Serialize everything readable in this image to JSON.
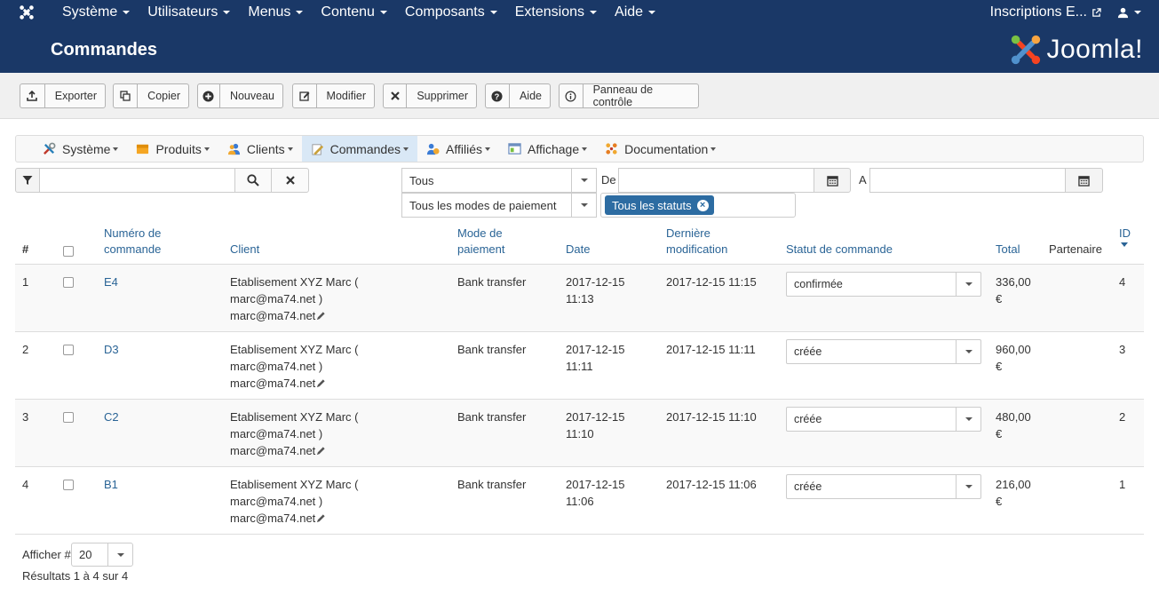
{
  "topbar": {
    "menu": [
      "Système",
      "Utilisateurs",
      "Menus",
      "Contenu",
      "Composants",
      "Extensions",
      "Aide"
    ],
    "site_label": "Inscriptions E...",
    "icons": {
      "logo": "joomla-icon",
      "external": "external-link-icon",
      "user": "user-icon"
    }
  },
  "header": {
    "title": "Commandes",
    "brand": "Joomla!"
  },
  "toolbar": {
    "buttons": [
      {
        "label": "Exporter",
        "icon": "upload-icon"
      },
      {
        "label": "Copier",
        "icon": "copy-icon"
      },
      {
        "label": "Nouveau",
        "icon": "plus-circle-icon"
      },
      {
        "label": "Modifier",
        "icon": "edit-icon"
      },
      {
        "label": "Supprimer",
        "icon": "x-icon"
      },
      {
        "label": "Aide",
        "icon": "question-icon"
      },
      {
        "label": "Panneau de contrôle",
        "icon": "info-icon"
      }
    ]
  },
  "submenu": {
    "items": [
      {
        "label": "Système",
        "icon": "tools-icon"
      },
      {
        "label": "Produits",
        "icon": "box-icon"
      },
      {
        "label": "Clients",
        "icon": "users-icon"
      },
      {
        "label": "Commandes",
        "icon": "pen-paper-icon",
        "active": true
      },
      {
        "label": "Affiliés",
        "icon": "affiliates-icon"
      },
      {
        "label": "Affichage",
        "icon": "window-icon"
      },
      {
        "label": "Documentation",
        "icon": "puzzle-icon"
      }
    ]
  },
  "filters": {
    "search_value": "",
    "type_select": "Tous",
    "payment_select": "Tous les modes de paiement",
    "from_label": "De",
    "to_label": "A",
    "from_value": "",
    "to_value": "",
    "status_chip": "Tous les statuts"
  },
  "table": {
    "headers": {
      "num": "#",
      "order_no": [
        "Numéro de",
        "commande"
      ],
      "client": "Client",
      "payment": [
        "Mode de",
        "paiement"
      ],
      "date": "Date",
      "modified": [
        "Dernière",
        "modification"
      ],
      "status": "Statut de commande",
      "total": "Total",
      "partner": "Partenaire",
      "id": "ID"
    },
    "rows": [
      {
        "num": "1",
        "order": "E4",
        "client": [
          "Etablisement XYZ Marc (",
          "marc@ma74.net )",
          "marc@ma74.net"
        ],
        "payment": "Bank transfer",
        "date": [
          "2017-12-15",
          "11:13"
        ],
        "modified": "2017-12-15 11:15",
        "status": "confirmée",
        "total": [
          "336,00",
          "€"
        ],
        "partner": "",
        "id": "4"
      },
      {
        "num": "2",
        "order": "D3",
        "client": [
          "Etablisement XYZ Marc (",
          "marc@ma74.net )",
          "marc@ma74.net"
        ],
        "payment": "Bank transfer",
        "date": [
          "2017-12-15",
          "11:11"
        ],
        "modified": "2017-12-15 11:11",
        "status": "créée",
        "total": [
          "960,00",
          "€"
        ],
        "partner": "",
        "id": "3"
      },
      {
        "num": "3",
        "order": "C2",
        "client": [
          "Etablisement XYZ Marc (",
          "marc@ma74.net )",
          "marc@ma74.net"
        ],
        "payment": "Bank transfer",
        "date": [
          "2017-12-15",
          "11:10"
        ],
        "modified": "2017-12-15 11:10",
        "status": "créée",
        "total": [
          "480,00",
          "€"
        ],
        "partner": "",
        "id": "2"
      },
      {
        "num": "4",
        "order": "B1",
        "client": [
          "Etablisement XYZ Marc (",
          "marc@ma74.net )",
          "marc@ma74.net"
        ],
        "payment": "Bank transfer",
        "date": [
          "2017-12-15",
          "11:06"
        ],
        "modified": "2017-12-15 11:06",
        "status": "créée",
        "total": [
          "216,00",
          "€"
        ],
        "partner": "",
        "id": "1"
      }
    ]
  },
  "footer": {
    "show_label": "Afficher #",
    "limit": "20",
    "results": "Résultats 1 à 4 sur 4"
  },
  "colors": {
    "header_bg": "#1a3867",
    "link": "#2a6496",
    "chip": "#2d6ca2",
    "active_tab": "#d9e8f6"
  }
}
